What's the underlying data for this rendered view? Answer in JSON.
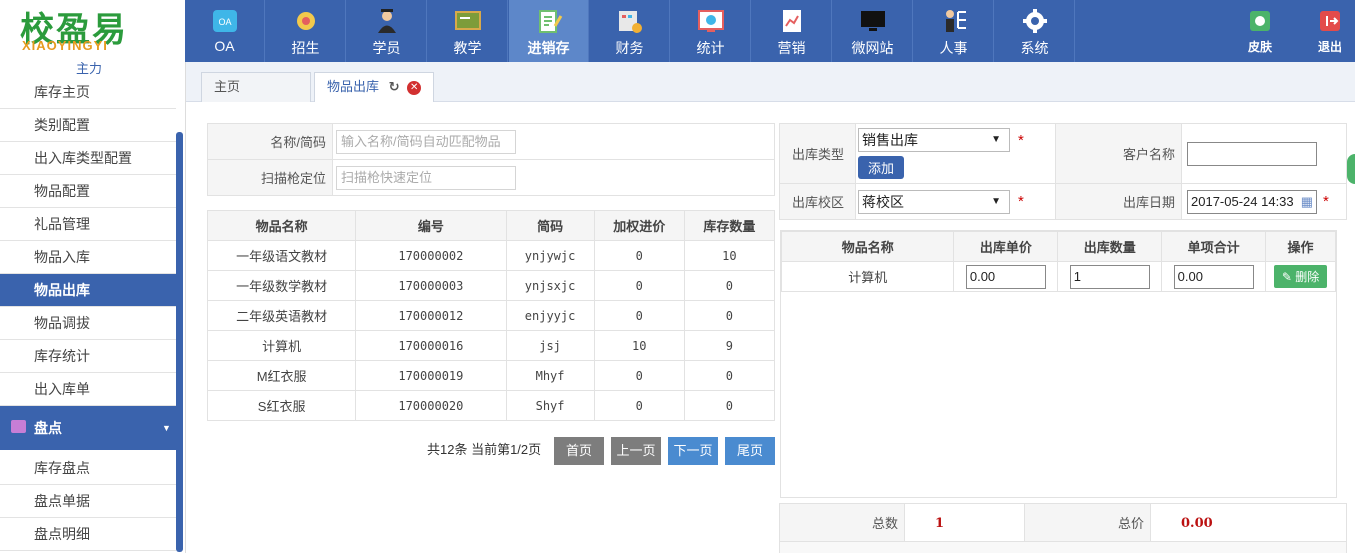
{
  "brand": {
    "name": "校盈易",
    "sub": "XIAOYINGYI"
  },
  "nav": [
    {
      "label": "OA",
      "icon": "oa-icon"
    },
    {
      "label": "招生",
      "icon": "enroll-icon"
    },
    {
      "label": "学员",
      "icon": "student-icon"
    },
    {
      "label": "教学",
      "icon": "teaching-icon"
    },
    {
      "label": "进销存",
      "icon": "inventory-icon",
      "active": true
    },
    {
      "label": "财务",
      "icon": "finance-icon"
    },
    {
      "label": "统计",
      "icon": "stats-icon"
    },
    {
      "label": "营销",
      "icon": "marketing-icon"
    },
    {
      "label": "微网站",
      "icon": "microsite-icon"
    },
    {
      "label": "人事",
      "icon": "hr-icon"
    },
    {
      "label": "系统",
      "icon": "gear-icon"
    }
  ],
  "right_nav": [
    {
      "label": "皮肤",
      "icon": "skin-icon"
    },
    {
      "label": "退出",
      "icon": "logout-icon"
    }
  ],
  "sidebar": {
    "top_partial": "主力",
    "items": [
      "库存主页",
      "类别配置",
      "出入库类型配置",
      "物品配置",
      "礼品管理",
      "物品入库",
      "物品出库",
      "物品调拔",
      "库存统计",
      "出入库单"
    ],
    "active_index": 6,
    "group": "盘点",
    "group_items": [
      "库存盘点",
      "盘点单据",
      "盘点明细"
    ]
  },
  "tabs": [
    {
      "label": "主页"
    },
    {
      "label": "物品出库"
    }
  ],
  "search": {
    "name_label": "名称/简码",
    "name_placeholder": "输入名称/简码自动匹配物品",
    "scan_label": "扫描枪定位",
    "scan_placeholder": "扫描枪快速定位"
  },
  "goods_table": {
    "headers": [
      "物品名称",
      "编号",
      "简码",
      "加权进价",
      "库存数量"
    ],
    "rows": [
      [
        "一年级语文教材",
        "170000002",
        "ynjywjc",
        "0",
        "10"
      ],
      [
        "一年级数学教材",
        "170000003",
        "ynjsxjc",
        "0",
        "0"
      ],
      [
        "二年级英语教材",
        "170000012",
        "enjyyjc",
        "0",
        "0"
      ],
      [
        "计算机",
        "170000016",
        "jsj",
        "10",
        "9"
      ],
      [
        "M红衣服",
        "170000019",
        "Mhyf",
        "0",
        "0"
      ],
      [
        "S红衣服",
        "170000020",
        "Shyf",
        "0",
        "0"
      ]
    ]
  },
  "pager": {
    "info": "共12条  当前第1/2页",
    "first": "首页",
    "prev": "上一页",
    "next": "下一页",
    "last": "尾页"
  },
  "form": {
    "type_label": "出库类型",
    "type_value": "销售出库",
    "add_label": "添加",
    "customer_label": "客户名称",
    "customer_value": "",
    "campus_label": "出库校区",
    "campus_value": "蒋校区",
    "date_label": "出库日期",
    "date_value": "2017-05-24 14:33"
  },
  "out_table": {
    "headers": [
      "物品名称",
      "出库单价",
      "出库数量",
      "单项合计",
      "操作"
    ],
    "rows": [
      {
        "name": "计算机",
        "price": "0.00",
        "qty": "1",
        "subtotal": "0.00",
        "action": "删除"
      }
    ]
  },
  "summary": {
    "count_label": "总数",
    "count_value": "1",
    "total_label": "总价",
    "total_value": "0.00"
  },
  "colors": {
    "primary": "#3a63ad",
    "danger": "#d23030",
    "success": "#4cb36a",
    "pager_gray": "#7d7d7d",
    "pager_blue": "#4a8bd0"
  }
}
